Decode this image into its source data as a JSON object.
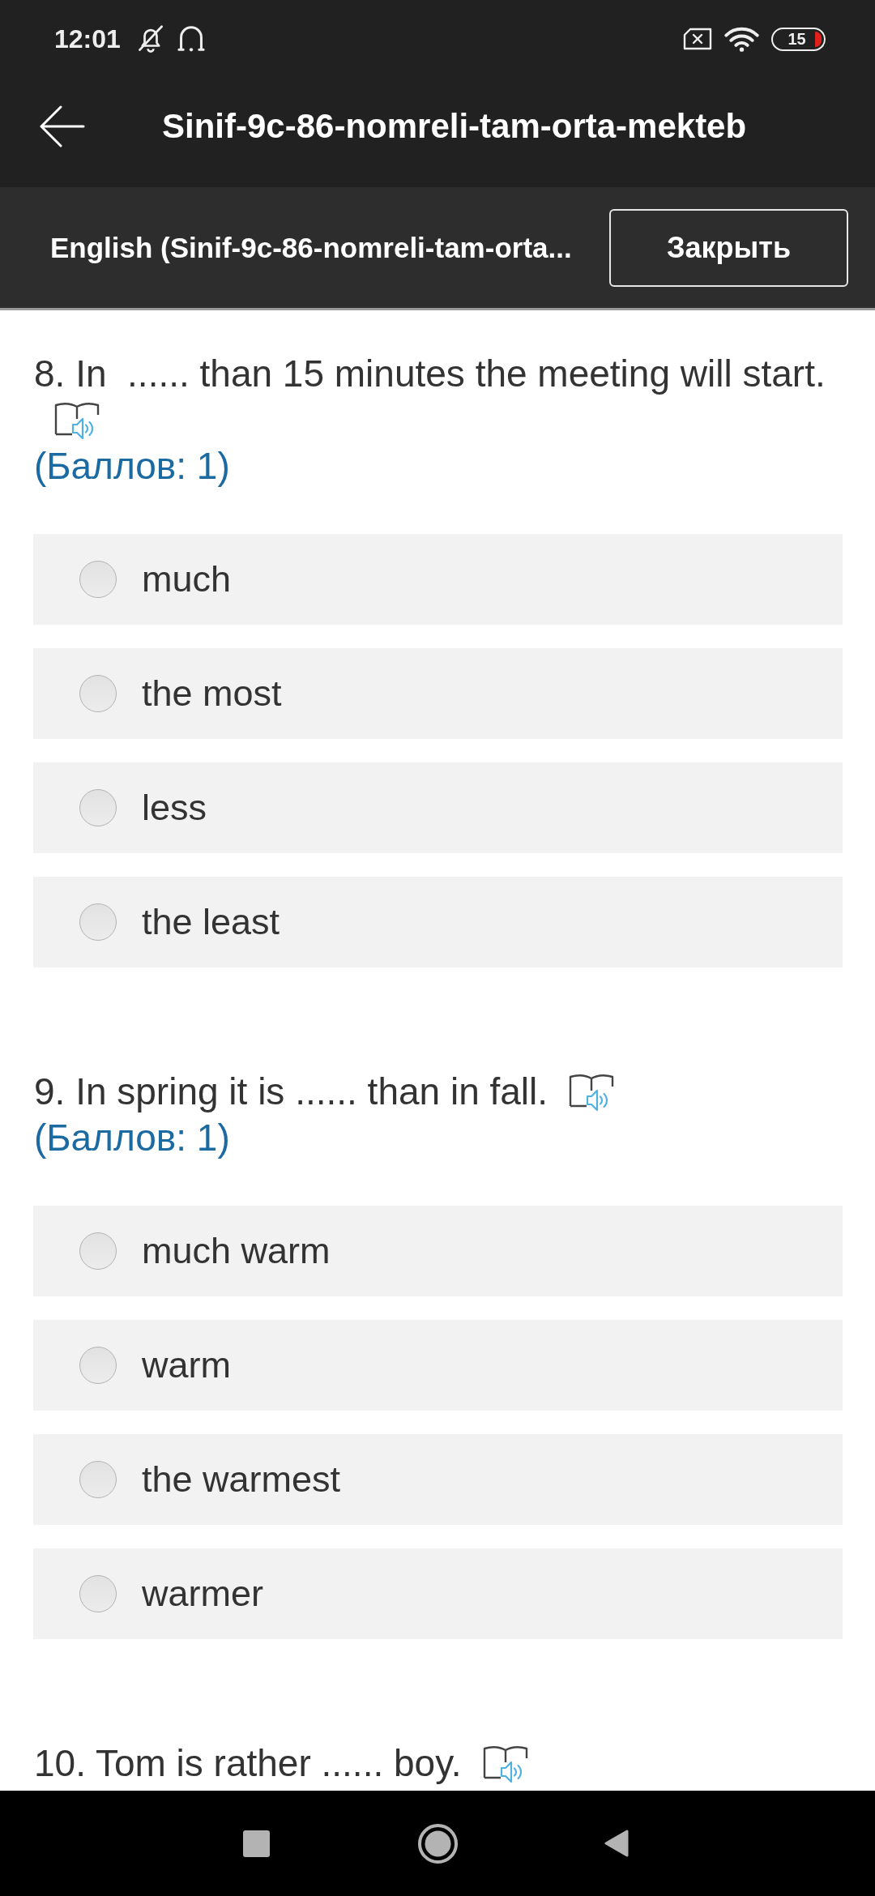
{
  "status_bar": {
    "time": "12:01",
    "battery": "15"
  },
  "app_bar": {
    "title": "Sinif-9c-86-nomreli-tam-orta-mekteb"
  },
  "quiz_bar": {
    "name": "English (Sinif-9c-86-nomreli-tam-orta...",
    "close_button": "Закрыть"
  },
  "questions": [
    {
      "text": "8. In  ...... than 15 minutes the meeting will start.",
      "points": "(Баллов: 1)",
      "options": [
        {
          "label": "much",
          "selected": false
        },
        {
          "label": "the most",
          "selected": false
        },
        {
          "label": "less",
          "selected": false
        },
        {
          "label": "the least",
          "selected": false
        }
      ]
    },
    {
      "text": "9. In spring it is ...... than in fall.",
      "points": "(Баллов: 1)",
      "options": [
        {
          "label": "much warm",
          "selected": false
        },
        {
          "label": "warm",
          "selected": false
        },
        {
          "label": "the warmest",
          "selected": false
        },
        {
          "label": "warmer",
          "selected": false
        }
      ]
    },
    {
      "text": "10. Tom is rather ...... boy."
    }
  ]
}
